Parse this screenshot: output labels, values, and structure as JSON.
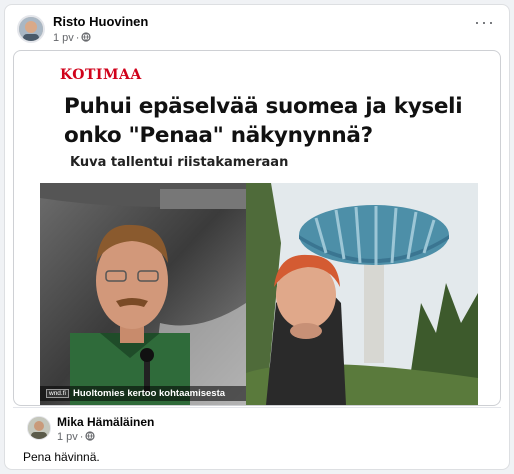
{
  "post": {
    "author": "Risto Huovinen",
    "time": "1 pv",
    "separator": "·",
    "audience_icon": "globe-icon",
    "more_label": "···"
  },
  "article": {
    "category": "KOTIMAA",
    "headline": "Puhui epäselvää suomea ja kyseli onko \"Penaa\" näkynynnä?",
    "subheadline": "Kuva tallentui riistakameraan",
    "caption_logo": "wnd.fi",
    "caption": "Huoltomies kertoo kohtaamisesta"
  },
  "comment": {
    "author": "Mika Hämäläinen",
    "time": "1 pv",
    "separator": "·",
    "audience_icon": "globe-icon",
    "text": "Pena hävinnä."
  }
}
